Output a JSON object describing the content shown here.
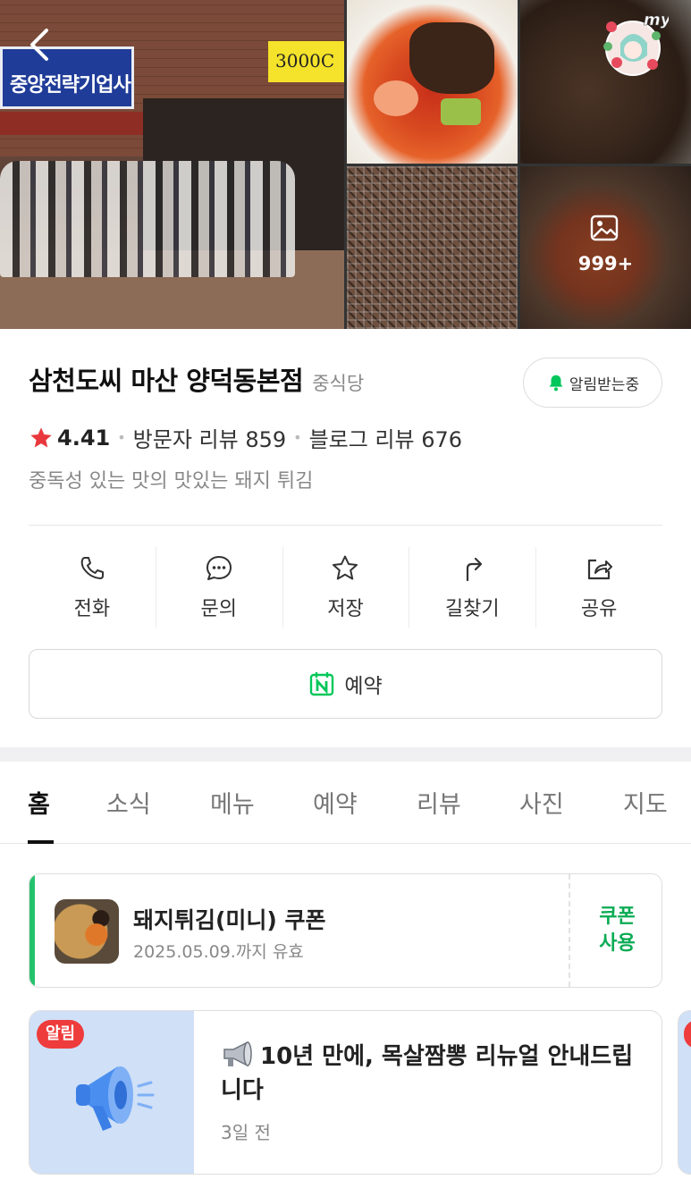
{
  "photos": {
    "signs": {
      "left_sign": "중앙전략기업사",
      "right_sign": "3000C"
    },
    "more_count": "999+"
  },
  "header": {
    "my_badge_label": "my"
  },
  "place": {
    "name": "삼천도씨 마산 양덕동본점",
    "category": "중식당",
    "alarm_label": "알림받는중",
    "rating": "4.41",
    "visitor_reviews": "방문자 리뷰 859",
    "blog_reviews": "블로그 리뷰 676",
    "description": "중독성 있는 맛의 맛있는 돼지 튀김"
  },
  "actions": [
    {
      "label": "전화",
      "icon": "phone-icon"
    },
    {
      "label": "문의",
      "icon": "chat-icon"
    },
    {
      "label": "저장",
      "icon": "star-icon"
    },
    {
      "label": "길찾기",
      "icon": "directions-icon"
    },
    {
      "label": "공유",
      "icon": "share-icon"
    }
  ],
  "reserve": {
    "label": "예약",
    "icon": "naver-calendar-icon"
  },
  "tabs": [
    "홈",
    "소식",
    "메뉴",
    "예약",
    "리뷰",
    "사진",
    "지도"
  ],
  "active_tab": "홈",
  "coupon": {
    "title": "돼지튀김(미니) 쿠폰",
    "valid_until": "2025.05.09.까지 유효",
    "use_label_line1": "쿠폰",
    "use_label_line2": "사용"
  },
  "notice": {
    "badge": "알림",
    "title": "10년 만에, 목살짬뽕 리뉴얼 안내드립니다",
    "time": "3일 전"
  },
  "colors": {
    "brand_green": "#03c75a",
    "coupon_text_green": "#0bab54",
    "rating_star": "#e8383d",
    "notice_badge": "#ee3b3b"
  }
}
